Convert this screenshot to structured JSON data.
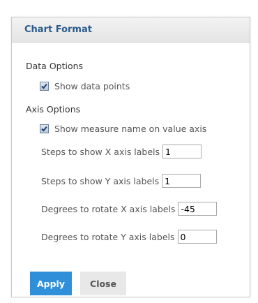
{
  "dialog": {
    "title": "Chart Format",
    "data_options": {
      "label": "Data Options",
      "show_data_points": {
        "label": "Show data points",
        "checked": true
      }
    },
    "axis_options": {
      "label": "Axis Options",
      "show_measure_name": {
        "label": "Show measure name on value axis",
        "checked": true
      },
      "steps_x": {
        "label": "Steps to show X axis labels",
        "value": "1"
      },
      "steps_y": {
        "label": "Steps to show Y axis labels",
        "value": "1"
      },
      "rotate_x": {
        "label": "Degrees to rotate X axis labels",
        "value": "-45"
      },
      "rotate_y": {
        "label": "Degrees to rotate Y axis labels",
        "value": "0"
      }
    },
    "buttons": {
      "apply": "Apply",
      "close": "Close"
    }
  },
  "colors": {
    "title": "#2b5b8c",
    "apply_button": "#2f8fd8",
    "close_button": "#e8e8e8"
  }
}
